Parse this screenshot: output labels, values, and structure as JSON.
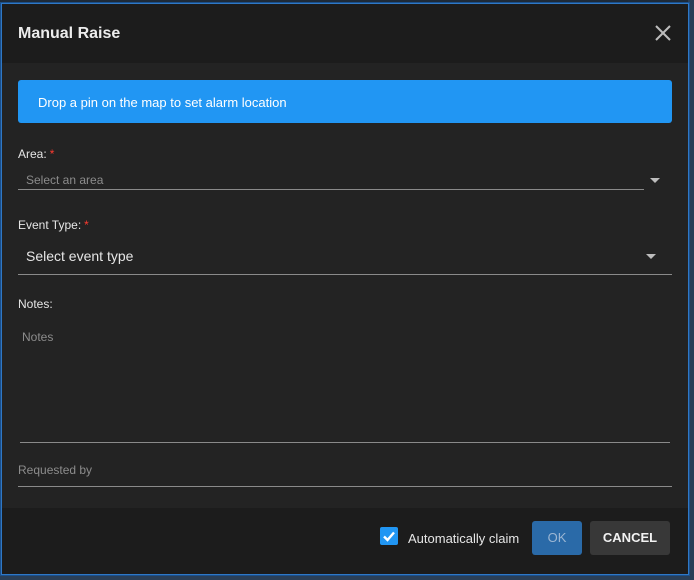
{
  "dialog": {
    "title": "Manual Raise",
    "banner": "Drop a pin on the map to set alarm location"
  },
  "form": {
    "area": {
      "label": "Area:",
      "required_mark": "*",
      "placeholder": "Select an area"
    },
    "event_type": {
      "label": "Event Type:",
      "required_mark": "*",
      "placeholder": "Select event type"
    },
    "notes": {
      "label": "Notes:",
      "placeholder": "Notes"
    },
    "requested_by": {
      "placeholder": "Requested by"
    }
  },
  "footer": {
    "auto_claim_label": "Automatically claim",
    "auto_claim_checked": true,
    "ok_label": "OK",
    "cancel_label": "CANCEL"
  },
  "icons": {
    "close": "close-icon",
    "dropdown": "chevron-down-icon",
    "check": "checkmark-icon"
  },
  "colors": {
    "dialog_bg": "#232323",
    "header_bg": "#1c1c1c",
    "accent": "#2196f3",
    "required": "#ff3b30",
    "ok_button": "#2a6aa8",
    "cancel_button": "#383838"
  }
}
